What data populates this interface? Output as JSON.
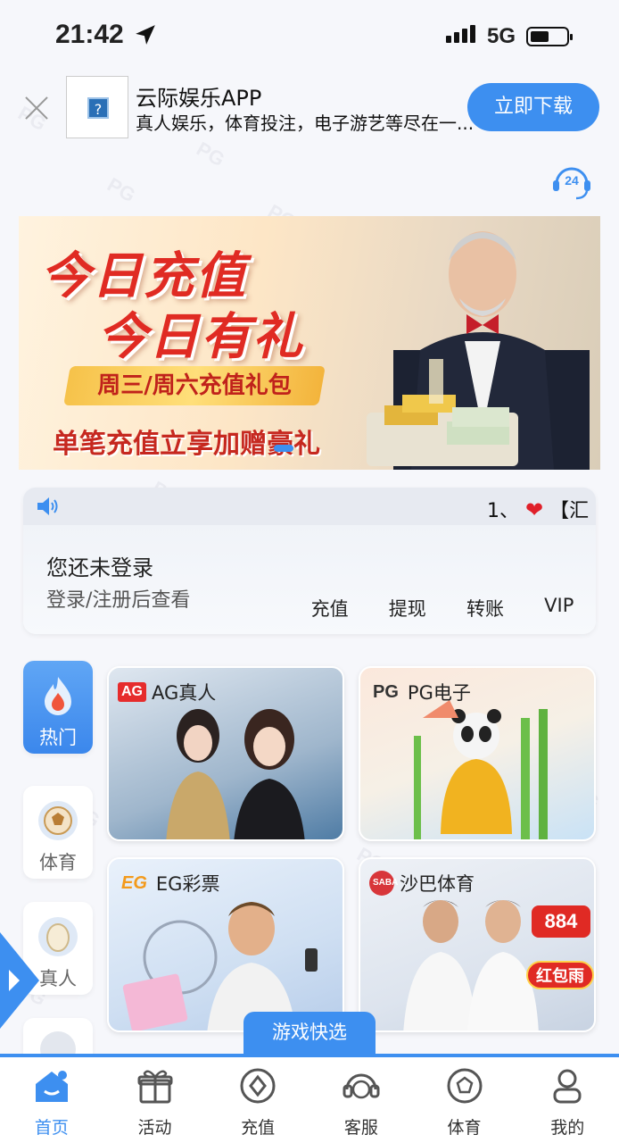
{
  "status_bar": {
    "time": "21:42",
    "network": "5G"
  },
  "app_banner": {
    "name": "云际娱乐APP",
    "description": "真人娱乐，体育投注，电子游艺等尽在一...",
    "download_label": "立即下载",
    "icon_placeholder": "?"
  },
  "support": {
    "label": "24"
  },
  "hero": {
    "line1": "今日充值",
    "line2": "今日有礼",
    "ribbon": "周三/周六充值礼包",
    "subtitle": "单笔充值立享加赠豪礼"
  },
  "notice": {
    "prefix": "1、",
    "heart": "❤",
    "text": "【汇"
  },
  "user_card": {
    "login_title": "您还未登录",
    "login_hint": "登录/注册后查看",
    "actions": [
      "充值",
      "提现",
      "转账",
      "VIP"
    ]
  },
  "categories": [
    {
      "label": "热门",
      "icon": "fire-icon",
      "active": true
    },
    {
      "label": "体育",
      "icon": "football-icon",
      "active": false
    },
    {
      "label": "真人",
      "icon": "egg-icon",
      "active": false
    }
  ],
  "games": [
    {
      "badge": "AG",
      "title": "AG真人"
    },
    {
      "badge": "PG",
      "title": "PG电子"
    },
    {
      "badge": "EG",
      "title": "EG彩票"
    },
    {
      "badge": "SABA",
      "title": "沙巴体育",
      "promo_number": "884",
      "promo_text": "红包雨"
    }
  ],
  "quick_select": "游戏快选",
  "tabs": [
    {
      "label": "首页",
      "icon": "home-icon",
      "active": true
    },
    {
      "label": "活动",
      "icon": "gift-icon",
      "active": false
    },
    {
      "label": "充值",
      "icon": "coin-icon",
      "active": false
    },
    {
      "label": "客服",
      "icon": "headset-icon",
      "active": false
    },
    {
      "label": "体育",
      "icon": "football-icon",
      "active": false
    },
    {
      "label": "我的",
      "icon": "user-icon",
      "active": false
    }
  ],
  "colors": {
    "accent": "#3d8ff0",
    "hero_red": "#e02b23"
  }
}
